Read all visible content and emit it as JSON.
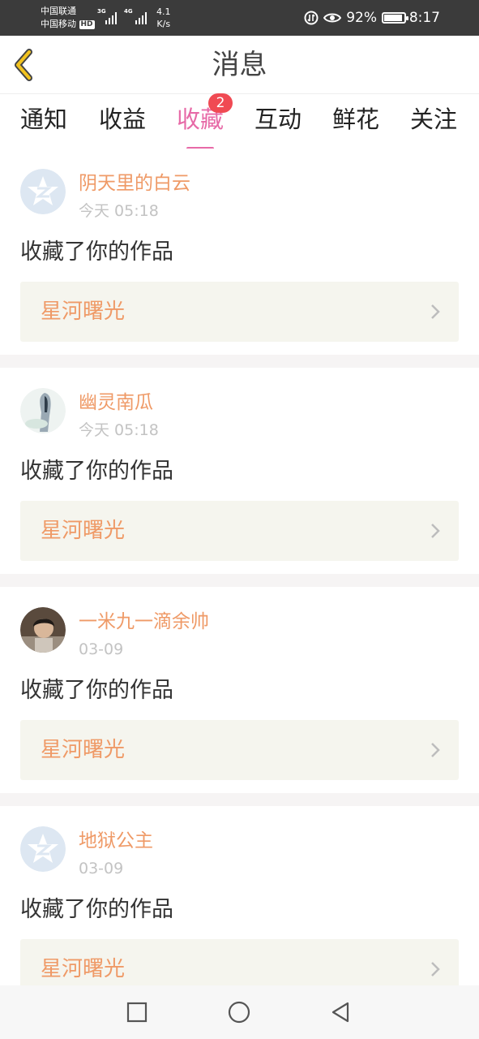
{
  "status": {
    "carrier1": "中国联通",
    "carrier2": "中国移动",
    "hd": "HD",
    "sig1": "3G",
    "sig2": "4G",
    "net_speed_value": "4.1",
    "net_speed_unit": "K/s",
    "battery_pct": "92%",
    "battery_level": 0.92,
    "time": "8:17"
  },
  "header": {
    "title": "消息"
  },
  "tabs": [
    {
      "label": "通知"
    },
    {
      "label": "收益"
    },
    {
      "label": "收藏",
      "badge": "2",
      "active": true
    },
    {
      "label": "互动"
    },
    {
      "label": "鲜花"
    },
    {
      "label": "关注"
    }
  ],
  "messages": [
    {
      "user": "阴天里的白云",
      "time": "今天 05:18",
      "action": "收藏了你的作品",
      "work": "星河曙光",
      "avatar": "default-qzone-icon"
    },
    {
      "user": "幽灵南瓜",
      "time": "今天 05:18",
      "action": "收藏了你的作品",
      "work": "星河曙光",
      "avatar": "anime-figure-photo"
    },
    {
      "user": "一米九一滴余帅",
      "time": "03-09",
      "action": "收藏了你的作品",
      "work": "星河曙光",
      "avatar": "child-photo"
    },
    {
      "user": "地狱公主",
      "time": "03-09",
      "action": "收藏了你的作品",
      "work": "星河曙光",
      "avatar": "default-qzone-icon"
    }
  ],
  "colors": {
    "accent": "#e76aa7",
    "username": "#ef9a67",
    "badge": "#f04a53",
    "back_arrow": "#f2c31f"
  }
}
